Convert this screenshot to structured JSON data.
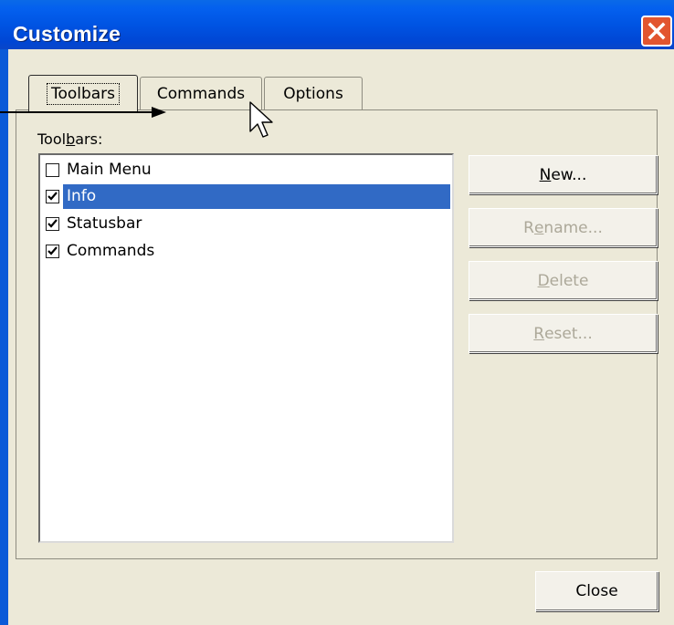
{
  "window": {
    "title": "Customize",
    "colors": {
      "titlebar": "#0054e3",
      "client": "#ece9d8",
      "close_button": "#e2552f",
      "selection": "#316ac5"
    }
  },
  "tabs": [
    {
      "label": "Toolbars",
      "active": true
    },
    {
      "label": "Commands",
      "active": false
    },
    {
      "label": "Options",
      "active": false
    }
  ],
  "toolbars_panel": {
    "list_label": {
      "before": "Tool",
      "accesskey": "b",
      "after": "ars:"
    },
    "items": [
      {
        "label": "Main Menu",
        "checked": false,
        "selected": false
      },
      {
        "label": "Info",
        "checked": true,
        "selected": true
      },
      {
        "label": "Statusbar",
        "checked": true,
        "selected": false
      },
      {
        "label": "Commands",
        "checked": true,
        "selected": false
      }
    ],
    "buttons": {
      "new": {
        "before": "",
        "accesskey": "N",
        "after": "ew...",
        "enabled": true
      },
      "rename": {
        "before": "R",
        "accesskey": "e",
        "after": "name...",
        "enabled": false
      },
      "delete": {
        "before": "",
        "accesskey": "D",
        "after": "elete",
        "enabled": false
      },
      "reset": {
        "before": "",
        "accesskey": "R",
        "after": "eset...",
        "enabled": false
      }
    }
  },
  "footer": {
    "close_label": "Close"
  },
  "icons": {
    "close": "close-icon",
    "check": "checkmark-icon",
    "cursor": "mouse-pointer-icon",
    "arrow": "annotation-arrow"
  }
}
